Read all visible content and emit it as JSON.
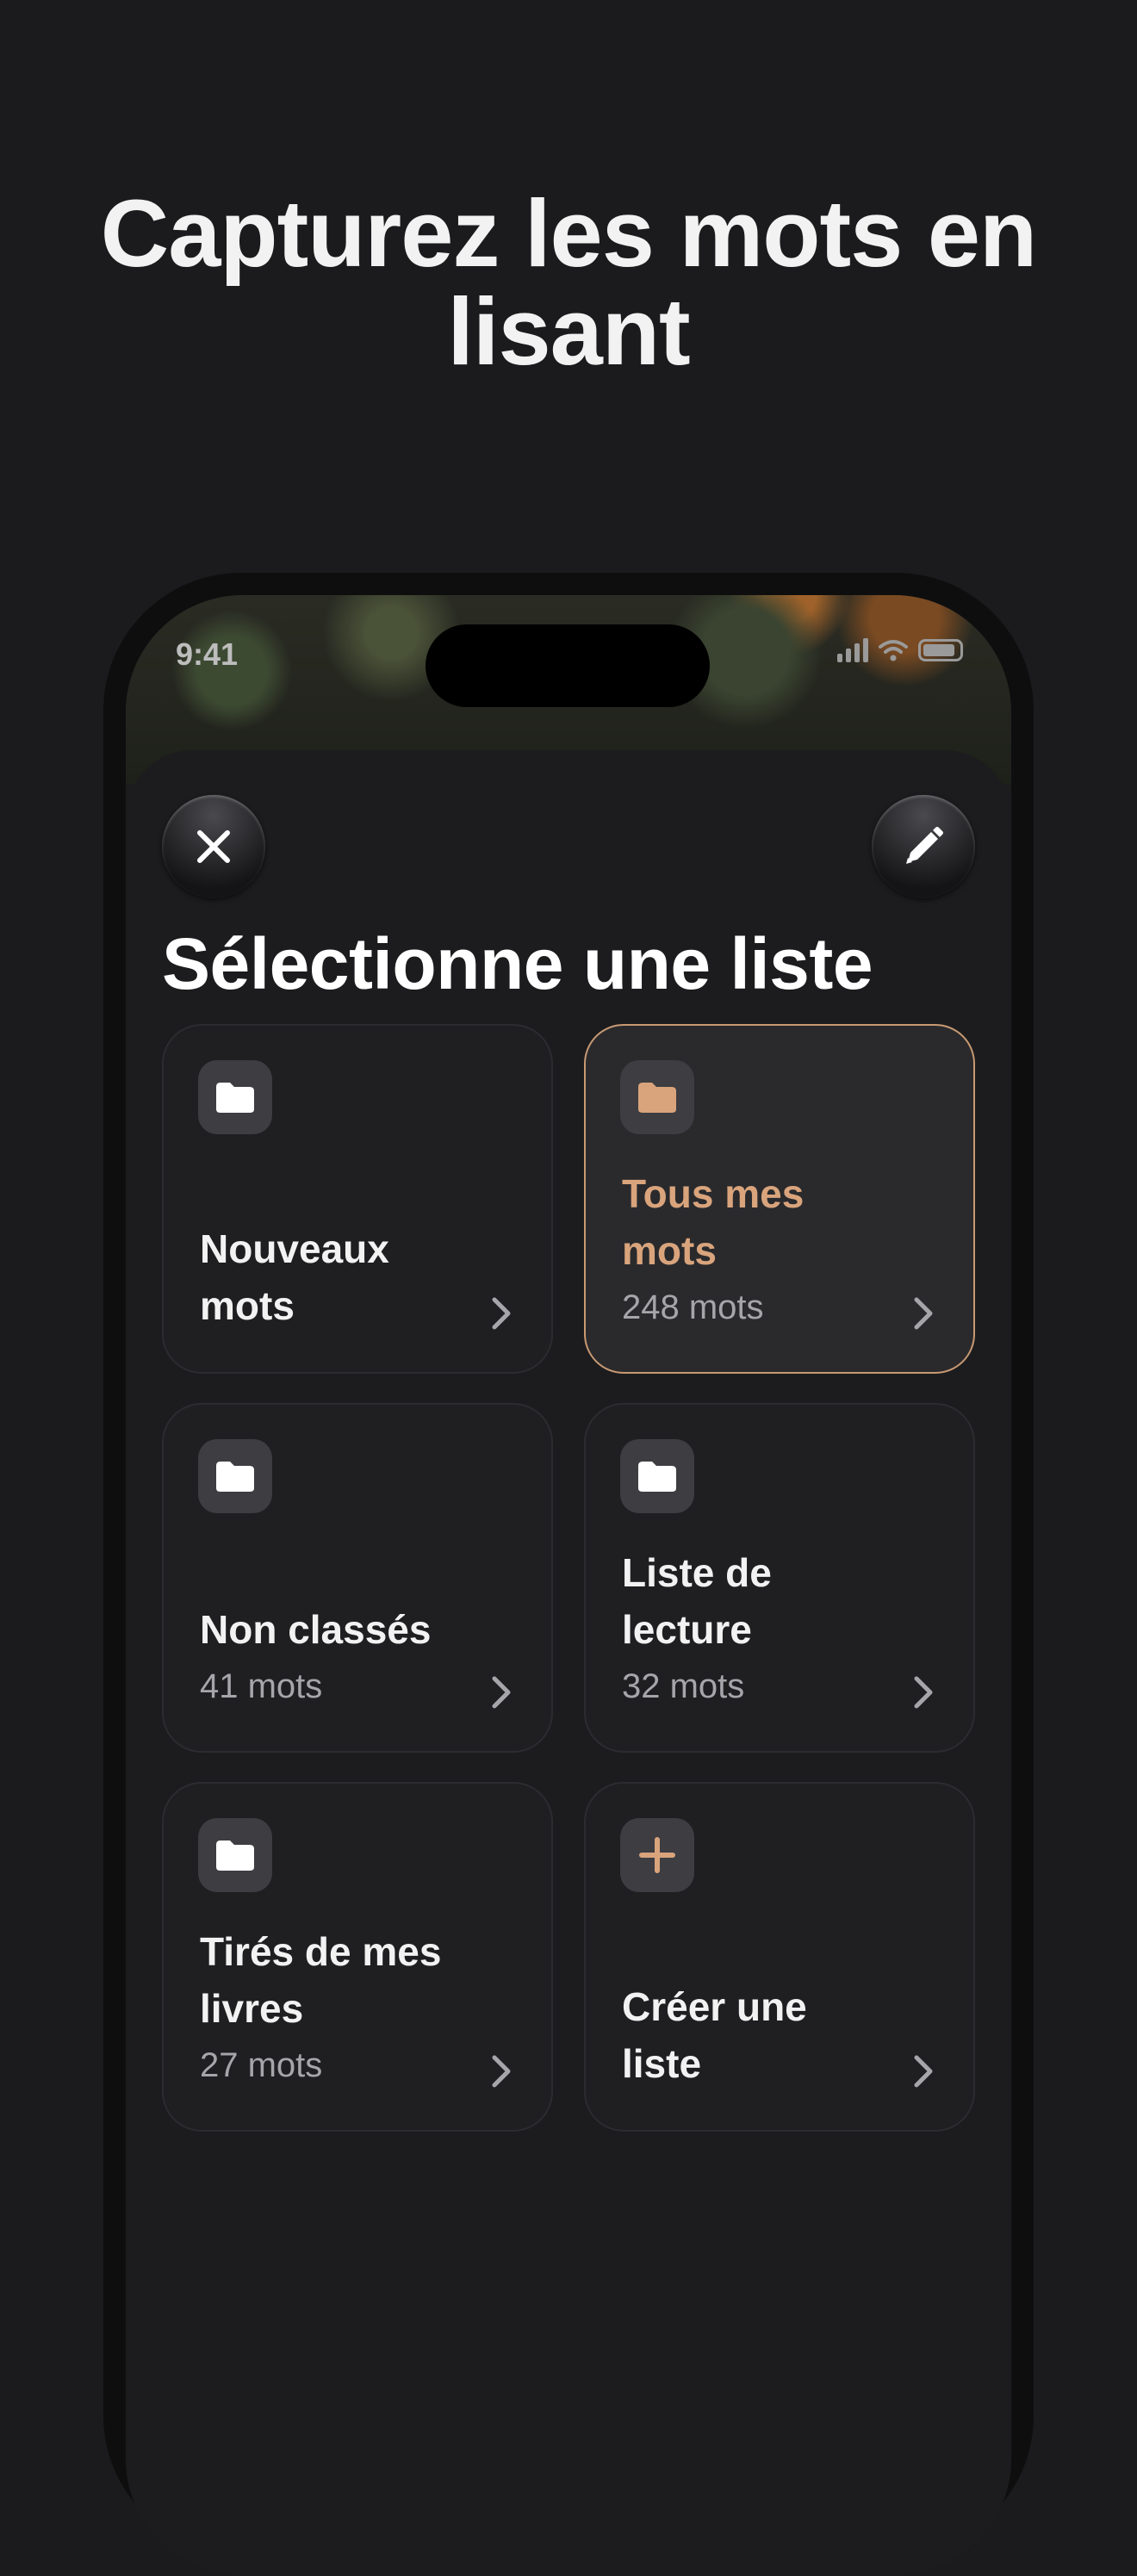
{
  "headline": {
    "line1": "Capturez les mots en",
    "line2": "lisant"
  },
  "status_bar": {
    "time": "9:41"
  },
  "sheet": {
    "title": "Sélectionne une liste",
    "close_icon": "close-icon",
    "edit_icon": "pencil-icon"
  },
  "lists": [
    {
      "title_line1": "Nouveaux",
      "title_line2": "mots",
      "count": "",
      "icon": "folder-icon"
    },
    {
      "title_line1": "Tous mes",
      "title_line2": "mots",
      "count": "248 mots",
      "icon": "folder-icon",
      "selected": true
    },
    {
      "title_line1": "Non classés",
      "title_line2": "",
      "count": "41 mots",
      "icon": "folder-icon"
    },
    {
      "title_line1": "Liste de",
      "title_line2": "lecture",
      "count": "32 mots",
      "icon": "folder-icon"
    },
    {
      "title_line1": "Tirés de mes",
      "title_line2": "livres",
      "count": "27 mots",
      "icon": "folder-icon"
    },
    {
      "title_line1": "Créer une",
      "title_line2": "liste",
      "count": "",
      "icon": "plus-icon"
    }
  ],
  "colors": {
    "accent": "#d9a47c",
    "background": "#1b1b1d",
    "card": "#1f1f22"
  }
}
